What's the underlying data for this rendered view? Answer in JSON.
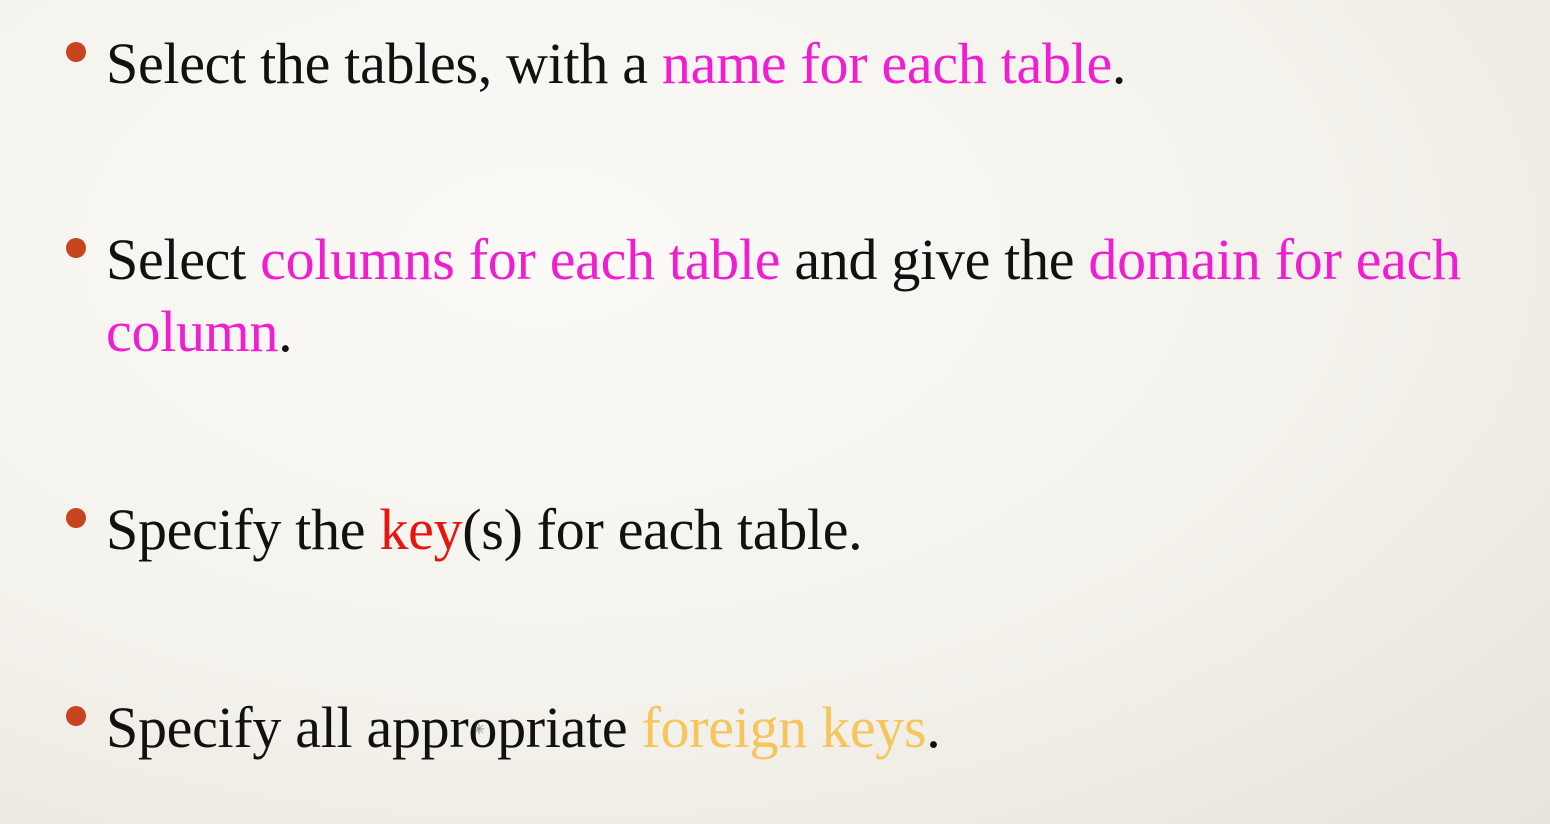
{
  "slide": {
    "bullets": [
      {
        "segments": [
          {
            "text": "Select the tables, with a ",
            "style": "plain"
          },
          {
            "text": "name for each table",
            "style": "magenta"
          },
          {
            "text": ".",
            "style": "plain"
          }
        ]
      },
      {
        "segments": [
          {
            "text": "Select ",
            "style": "plain"
          },
          {
            "text": "columns for each table",
            "style": "magenta"
          },
          {
            "text": " and give the ",
            "style": "plain"
          },
          {
            "text": "domain for each column",
            "style": "magenta"
          },
          {
            "text": ".",
            "style": "plain"
          }
        ]
      },
      {
        "segments": [
          {
            "text": "Specify the ",
            "style": "plain"
          },
          {
            "text": "key",
            "style": "red"
          },
          {
            "text": "(s) for each table.",
            "style": "plain"
          }
        ]
      },
      {
        "segments": [
          {
            "text": "Specify all appropriate ",
            "style": "plain"
          },
          {
            "text": "foreign keys",
            "style": "gold"
          },
          {
            "text": ".",
            "style": "plain"
          }
        ]
      }
    ]
  },
  "colors": {
    "text": "#111111",
    "magenta": "#f01ed1",
    "red": "#e8140e",
    "gold": "#f6c55b",
    "bullet": "#c6441f",
    "background": "#f4f2ec"
  },
  "icons": {
    "bullet": "bullet-dot-icon",
    "cursor": "mouse-cursor-icon"
  }
}
